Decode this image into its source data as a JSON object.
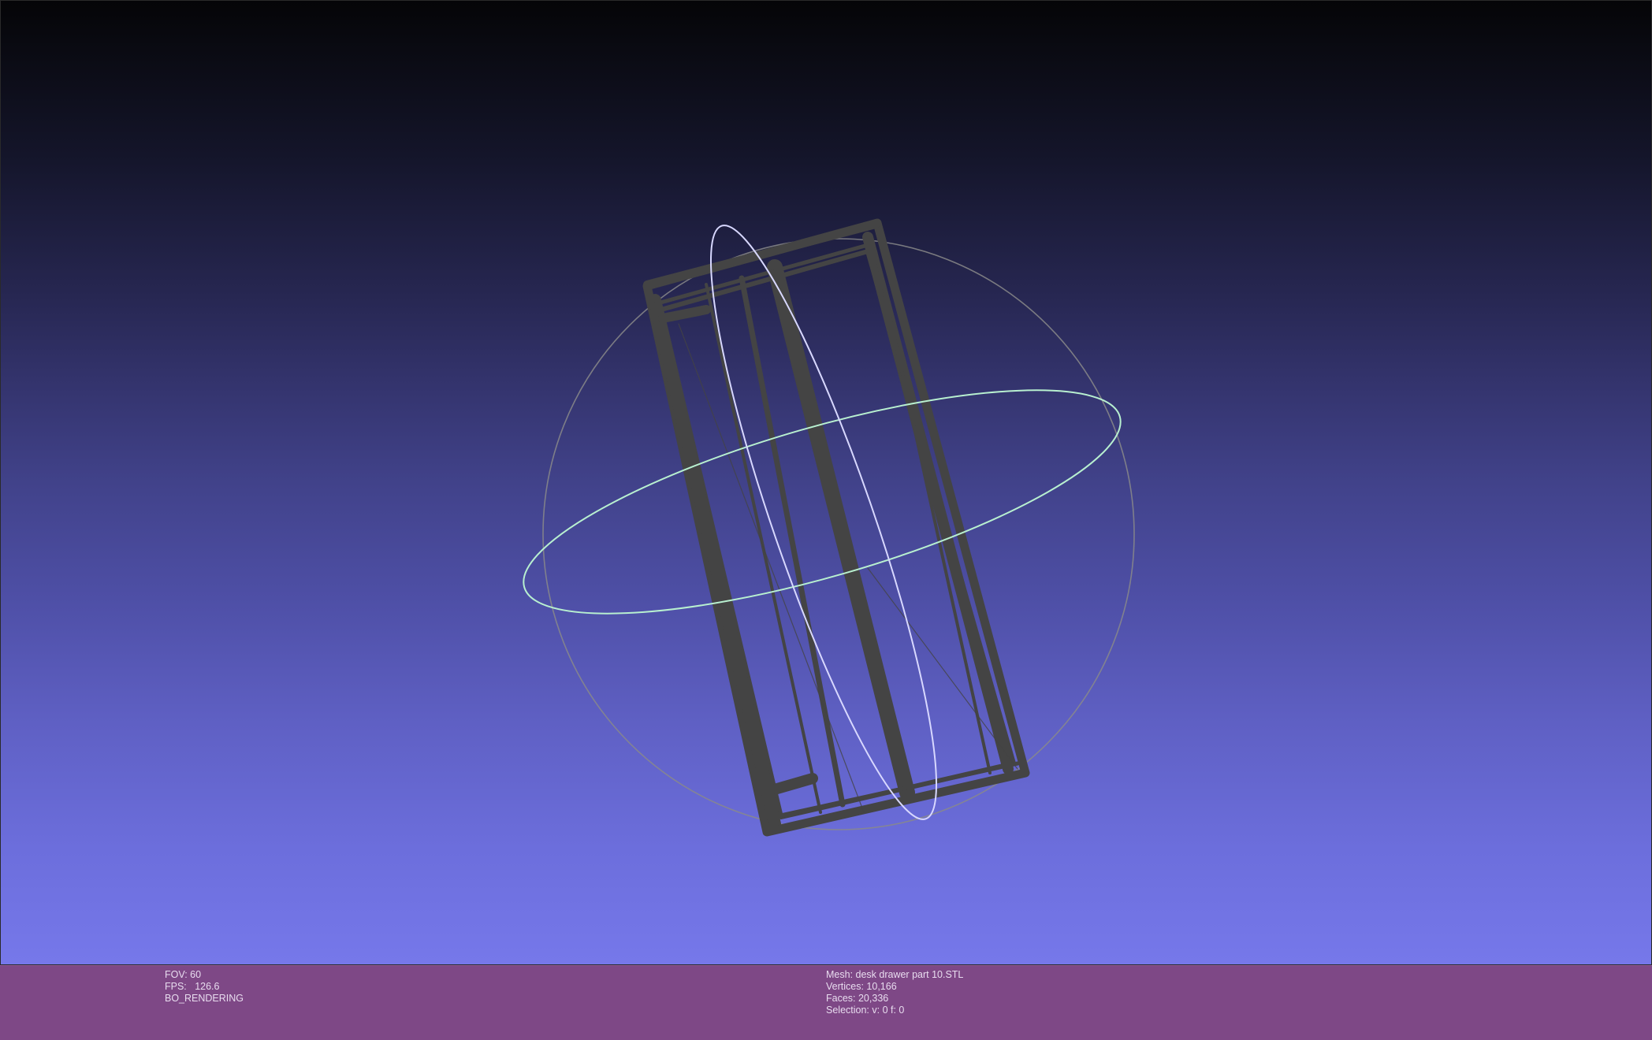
{
  "viewer": {
    "background_top": "#050507",
    "background_bottom": "#7678ea",
    "info_bar_color": "#7e4886",
    "mesh_color": "#444444",
    "trackball_colors": {
      "sphere": "#8a8a8a",
      "horizontal_ring": "#b8f0d0",
      "vertical_ring": "#d8d8ff"
    }
  },
  "render_info": {
    "fov": "FOV: 60",
    "fps": "FPS:   126.6",
    "mode": "BO_RENDERING"
  },
  "mesh_info": {
    "mesh": "Mesh: desk drawer part 10.STL",
    "vertices": "Vertices: 10,166",
    "faces": "Faces: 20,336",
    "selection": "Selection: v: 0 f: 0"
  }
}
